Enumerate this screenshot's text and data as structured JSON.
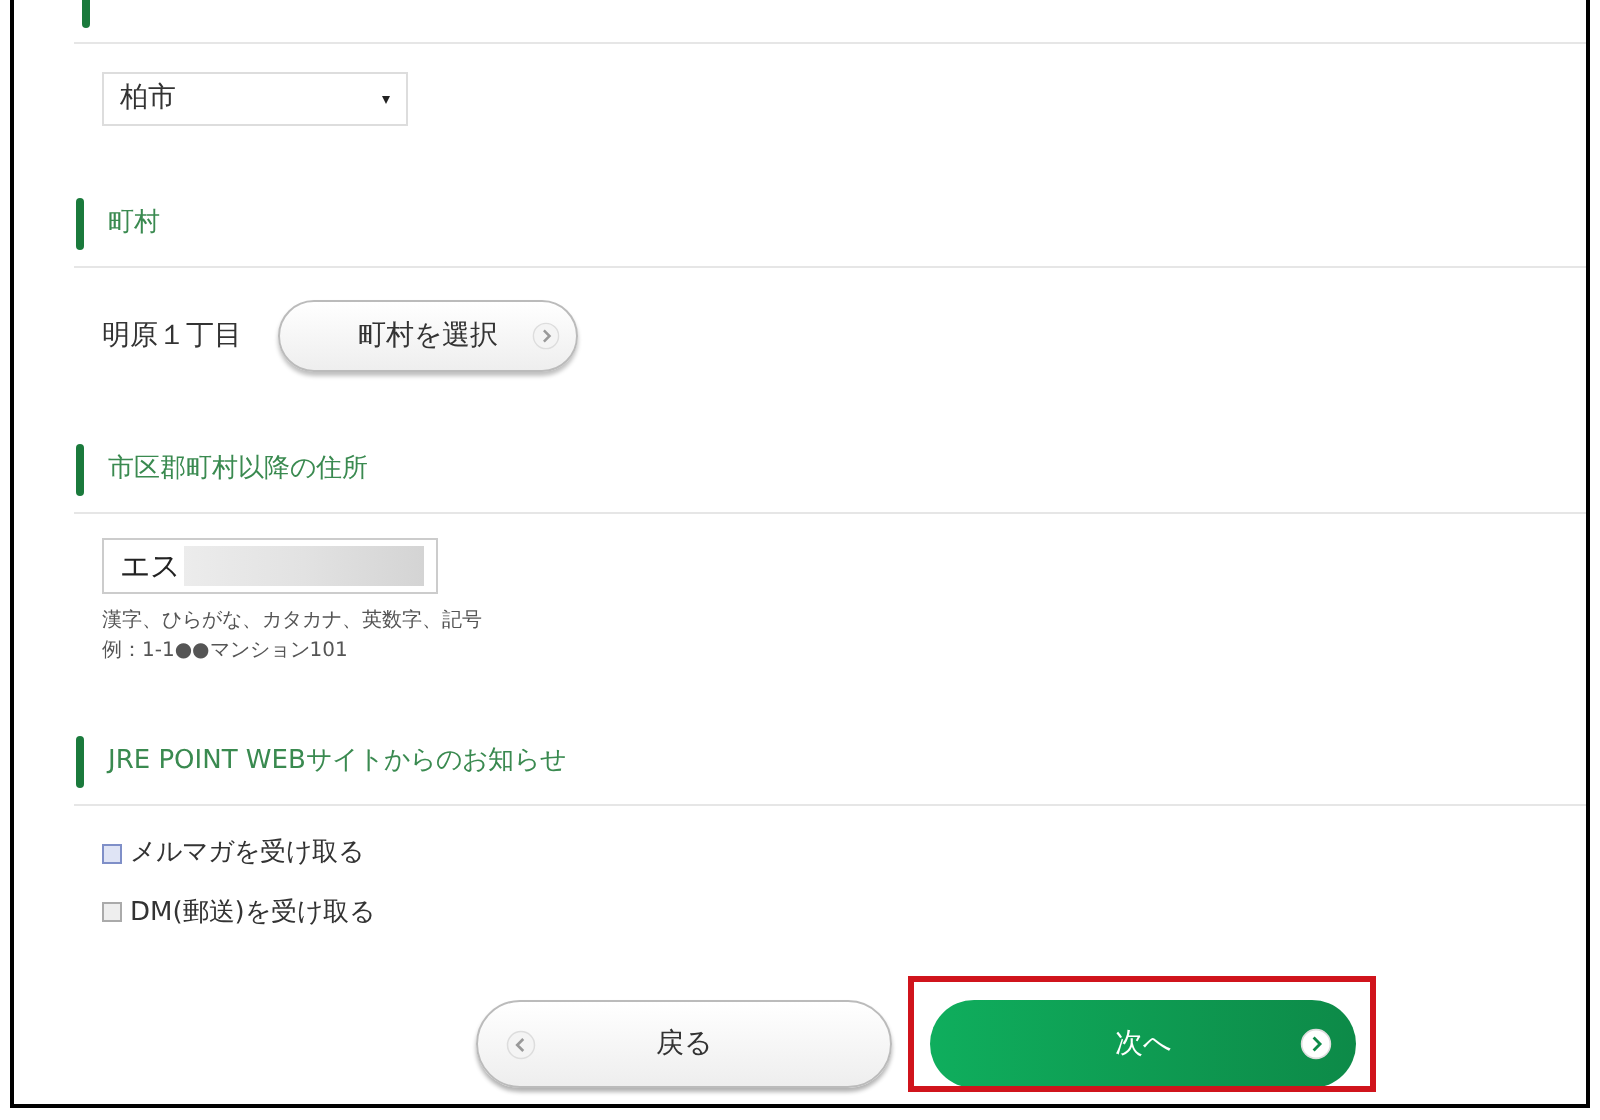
{
  "city_select": {
    "value": "柏市"
  },
  "sections": [
    {
      "kind": "town",
      "title": "町村",
      "town": "明原１丁目",
      "button": "町村を選択"
    },
    {
      "kind": "address",
      "title": "市区郡町村以降の住所",
      "value": "エス",
      "hints": [
        "漢字、ひらがな、カタカナ、英数字、記号",
        "例：1-1●●マンション101"
      ]
    },
    {
      "kind": "notices",
      "title": "JRE POINT WEBサイトからのお知らせ",
      "options": [
        {
          "label": "メルマガを受け取る",
          "checked": false,
          "focused": true
        },
        {
          "label": "DM(郵送)を受け取る",
          "checked": false,
          "focused": false
        }
      ]
    }
  ],
  "buttons": {
    "back": "戻る",
    "next": "次へ",
    "next_highlighted": true
  }
}
